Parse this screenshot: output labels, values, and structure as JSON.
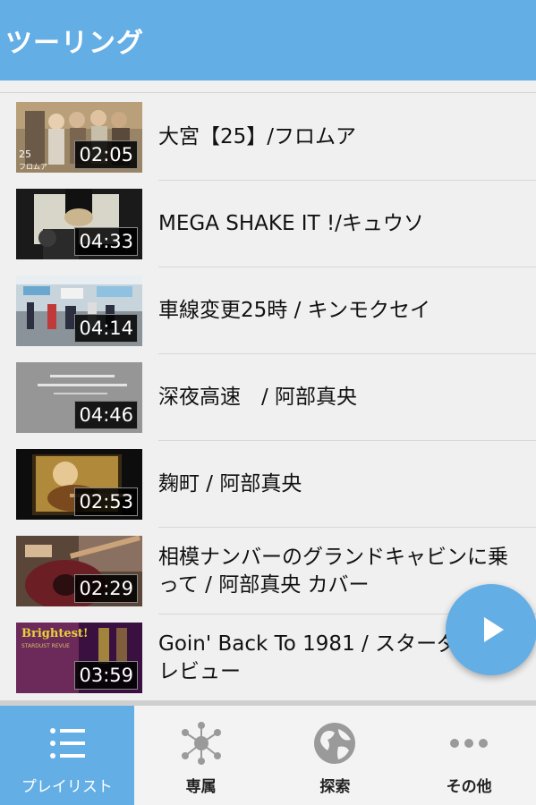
{
  "header": {
    "title": "ツーリング"
  },
  "playlist": [
    {
      "title": "大宮【25】/フロムア",
      "duration": "02:05",
      "thumb_caption": "25\nフロムア"
    },
    {
      "title": "MEGA SHAKE IT !/キュウソ",
      "duration": "04:33"
    },
    {
      "title": "車線変更25時 / キンモクセイ",
      "duration": "04:14"
    },
    {
      "title": "深夜高速　/ 阿部真央",
      "duration": "04:46"
    },
    {
      "title": "麹町 / 阿部真央",
      "duration": "02:53"
    },
    {
      "title": "相模ナンバーのグランドキャビンに乗って / 阿部真央 カバー",
      "duration": "02:29"
    },
    {
      "title": "Goin' Back To 1981 / スターダスト☆レビュー",
      "duration": "03:59",
      "thumb_caption": "Brightest!"
    }
  ],
  "fab": {
    "icon": "play-icon"
  },
  "bottom_nav": [
    {
      "label": "プレイリスト",
      "icon": "list-icon",
      "active": true
    },
    {
      "label": "専属",
      "icon": "network-icon",
      "active": false
    },
    {
      "label": "探索",
      "icon": "globe-icon",
      "active": false
    },
    {
      "label": "その他",
      "icon": "more-icon",
      "active": false
    }
  ],
  "colors": {
    "accent": "#64aee6",
    "background": "#f0f0f0"
  }
}
